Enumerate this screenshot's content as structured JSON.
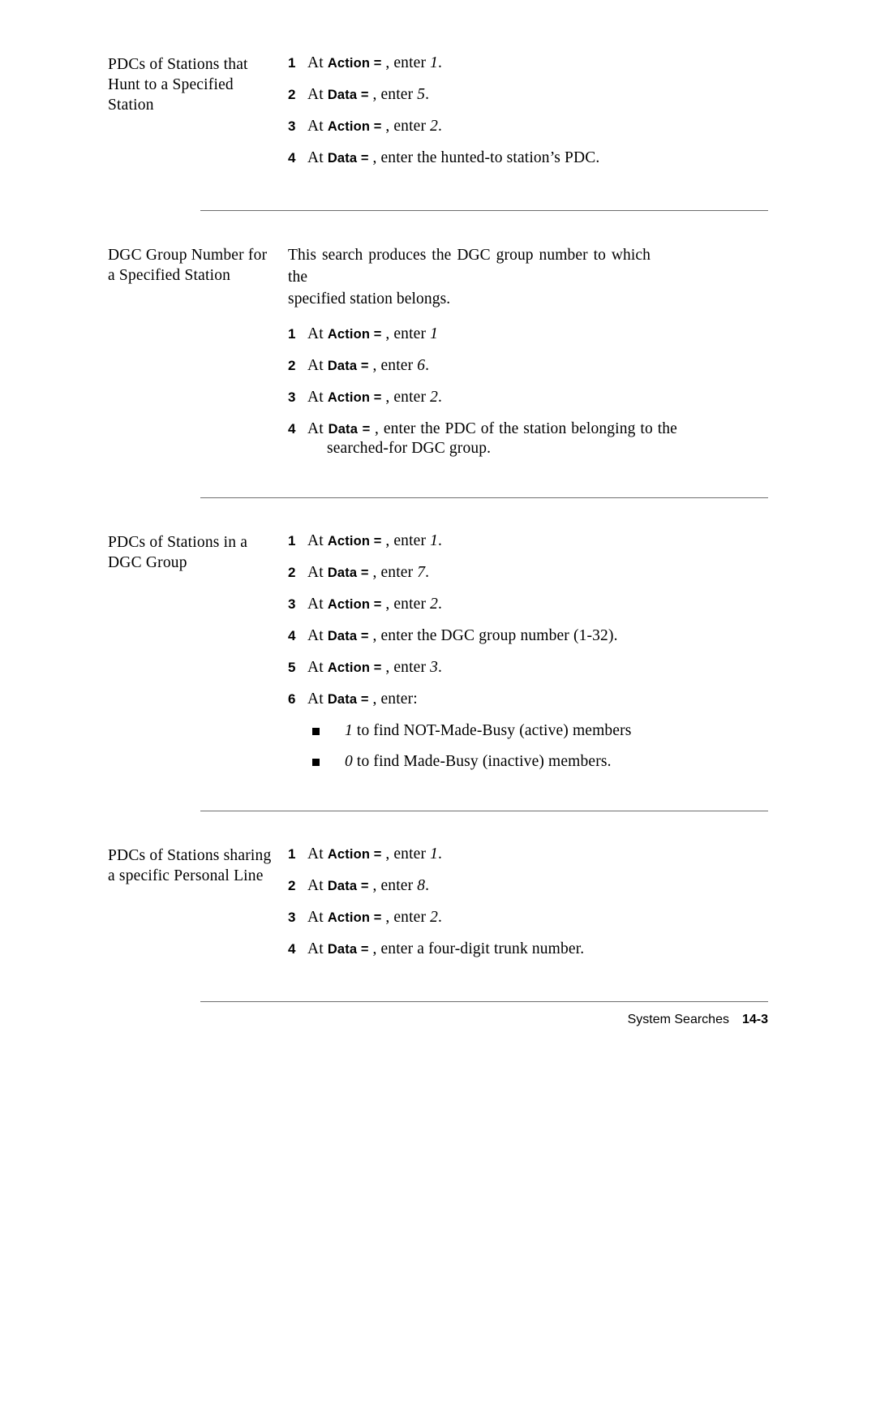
{
  "page": {
    "footer_text": "System Searches",
    "page_number": "14-3"
  },
  "sections": [
    {
      "heading_lines": [
        "PDCs of Stations that",
        "Hunt to a Specified",
        "Station"
      ],
      "intro": null,
      "steps": [
        {
          "num": "1",
          "at": "At ",
          "kw": "Action  = ",
          "tail": ", enter  ",
          "value": "1",
          "after": "."
        },
        {
          "num": "2",
          "at": "At ",
          "kw": "Data  = ",
          "tail": ", enter  ",
          "value": "5",
          "after": "."
        },
        {
          "num": "3",
          "at": "At ",
          "kw": "Action  = ",
          "tail": ", enter  ",
          "value": "2",
          "after": "."
        },
        {
          "num": "4",
          "at": "At ",
          "kw": "Data = ",
          "tail": ", enter  the  hunted-to  station’s  PDC.",
          "value": "",
          "after": ""
        }
      ],
      "bullets": []
    },
    {
      "heading_lines": [
        "DGC Group Number for",
        "a Specified Station"
      ],
      "intro_lines": [
        "This search produces the DGC group number to which the",
        "specified station belongs."
      ],
      "steps": [
        {
          "num": "1",
          "at": "At ",
          "kw": "Action  = ",
          "tail": ", enter  ",
          "value": "1",
          "after": ""
        },
        {
          "num": "2",
          "at": "At ",
          "kw": "Data = ",
          "tail": ", enter  ",
          "value": "6",
          "after": "."
        },
        {
          "num": "3",
          "at": "At ",
          "kw": "Action  = ",
          "tail": ", enter  ",
          "value": "2",
          "after": "."
        },
        {
          "num": "4",
          "at": "At ",
          "kw": "Data = ",
          "tail": ", enter  the  PDC  of  the  station  belonging  to  the",
          "value": "",
          "after": "",
          "wrap2": "searched-for  DGC  group."
        }
      ],
      "bullets": []
    },
    {
      "heading_lines": [
        "PDCs of Stations in a",
        "DGC  Group"
      ],
      "intro": null,
      "steps": [
        {
          "num": "1",
          "at": "At ",
          "kw": "Action  = ",
          "tail": ", enter  ",
          "value": "1",
          "after": "."
        },
        {
          "num": "2",
          "at": "At ",
          "kw": "Data = ",
          "tail": ", enter  ",
          "value": "7",
          "after": "."
        },
        {
          "num": "3",
          "at": "At ",
          "kw": "Action  = ",
          "tail": ", enter ",
          "value": "2",
          "after": "."
        },
        {
          "num": "4",
          "at": "At ",
          "kw": "Data = ",
          "tail": ", enter  the  DGC  group  number  (1-32).",
          "value": "",
          "after": ""
        },
        {
          "num": "5",
          "at": "At ",
          "kw": "Action  = ",
          "tail": ", enter  ",
          "value": "3",
          "after": "."
        },
        {
          "num": "6",
          "at": "At ",
          "kw": "Data  = ",
          "tail": ", enter:",
          "value": "",
          "after": ""
        }
      ],
      "bullets": [
        {
          "value": "1",
          "text": " to find  NOT-Made-Busy  (active)  members"
        },
        {
          "value": "0",
          "text": " to  find  Made-Busy  (inactive)  members."
        }
      ]
    },
    {
      "heading_lines": [
        "PDCs of Stations sharing",
        "a specific Personal Line"
      ],
      "intro": null,
      "steps": [
        {
          "num": "1",
          "at": "At ",
          "kw": "Action  = ",
          "tail": ", enter  ",
          "value": "1",
          "after": "."
        },
        {
          "num": "2",
          "at": "At ",
          "kw": "Data  = ",
          "tail": ", enter  ",
          "value": "8",
          "after": "."
        },
        {
          "num": "3",
          "at": "At ",
          "kw": "Action  = ",
          "tail": ", enter  ",
          "value": "2",
          "after": "."
        },
        {
          "num": "4",
          "at": "At ",
          "kw": "Data = ",
          "tail": ", enter  a  four-digit  trunk  number.",
          "value": "",
          "after": ""
        }
      ],
      "bullets": []
    }
  ]
}
